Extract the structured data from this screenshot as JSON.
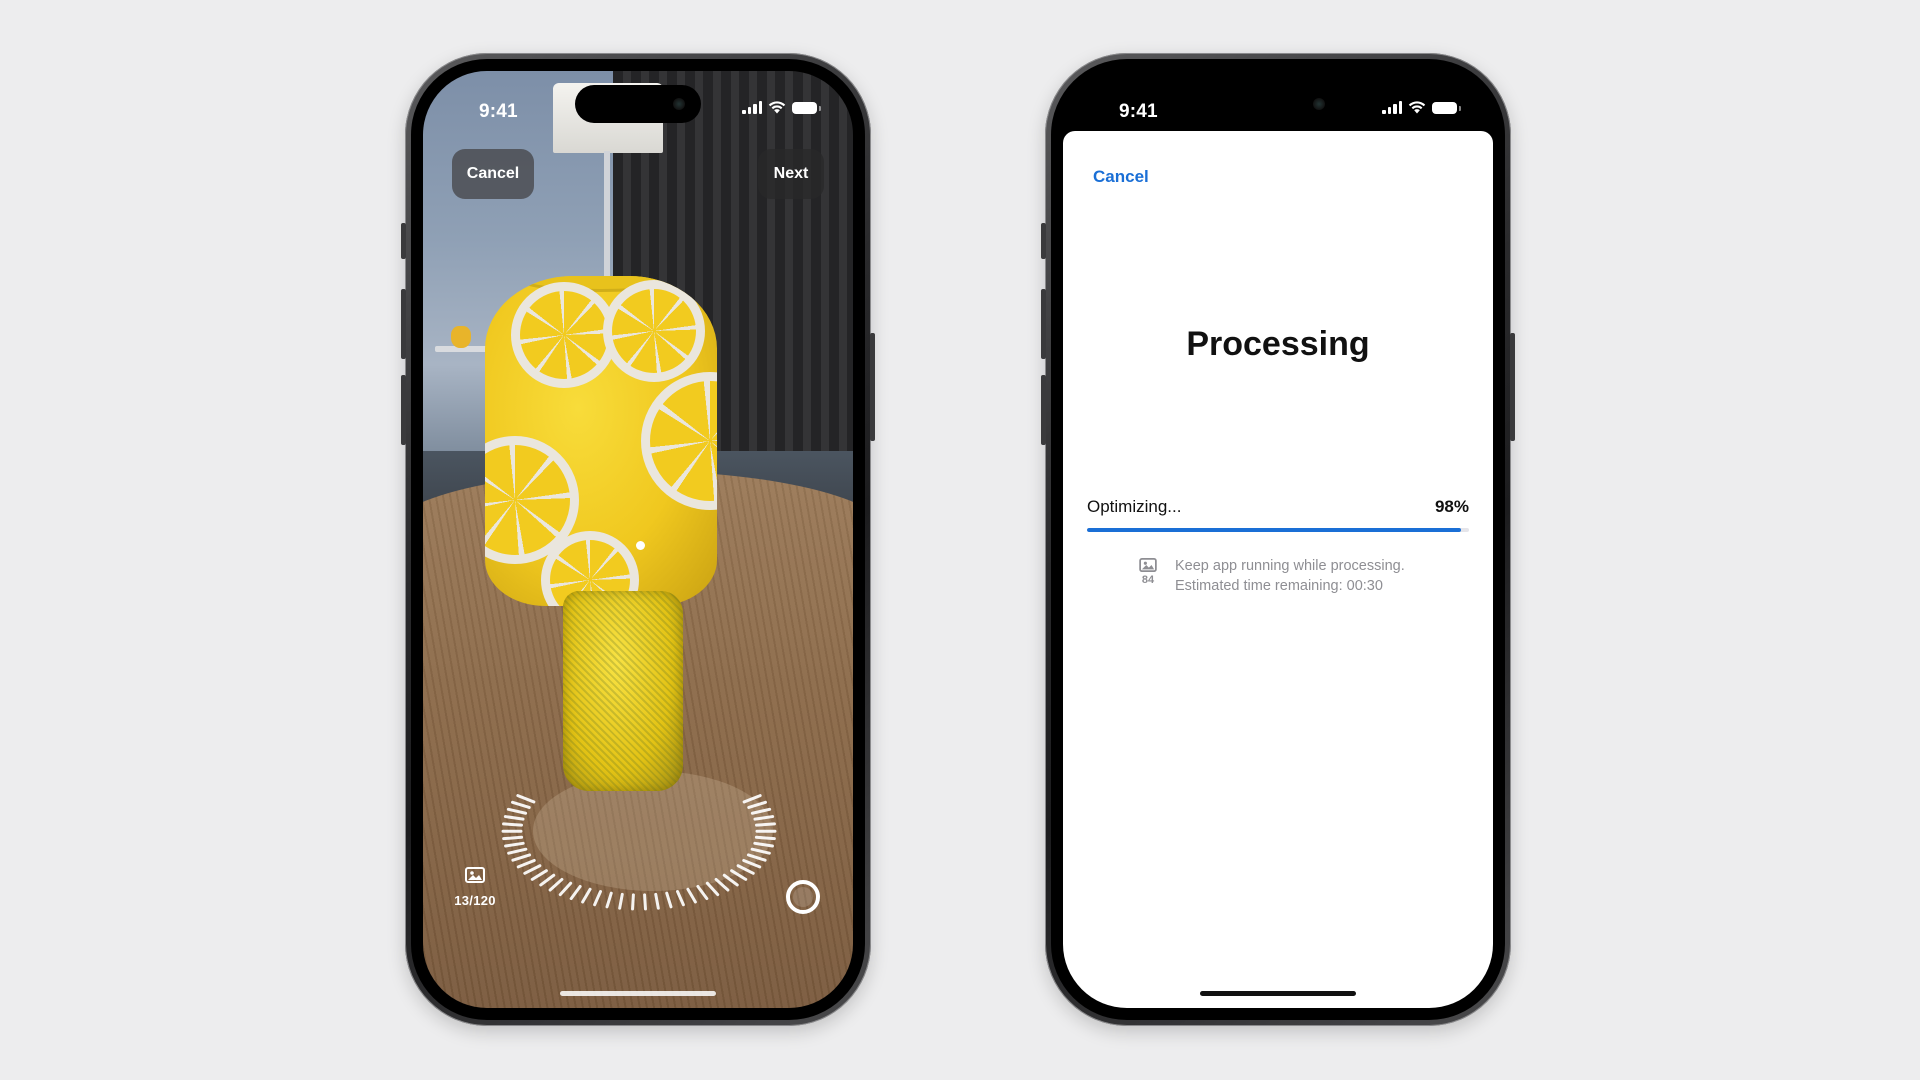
{
  "capture_screen": {
    "status_time": "9:41",
    "cancel_label": "Cancel",
    "next_label": "Next",
    "shot_count": "13/120",
    "icons": {
      "signal": "cellular-signal-icon",
      "wifi": "wifi-icon",
      "battery": "battery-icon",
      "photo": "photo-stack-icon",
      "shutter": "shutter-button-icon"
    }
  },
  "processing_screen": {
    "status_time": "9:41",
    "cancel_label": "Cancel",
    "title": "Processing",
    "progress_label": "Optimizing...",
    "progress_percent": "98%",
    "progress_value": 0.98,
    "image_count": "84",
    "info_line_1": "Keep app running while processing.",
    "info_line_2": "Estimated time remaining: 00:30",
    "accent_color": "#1a6fd6",
    "icons": {
      "signal": "cellular-signal-icon",
      "wifi": "wifi-icon",
      "battery": "battery-icon",
      "photo": "photo-icon"
    }
  }
}
